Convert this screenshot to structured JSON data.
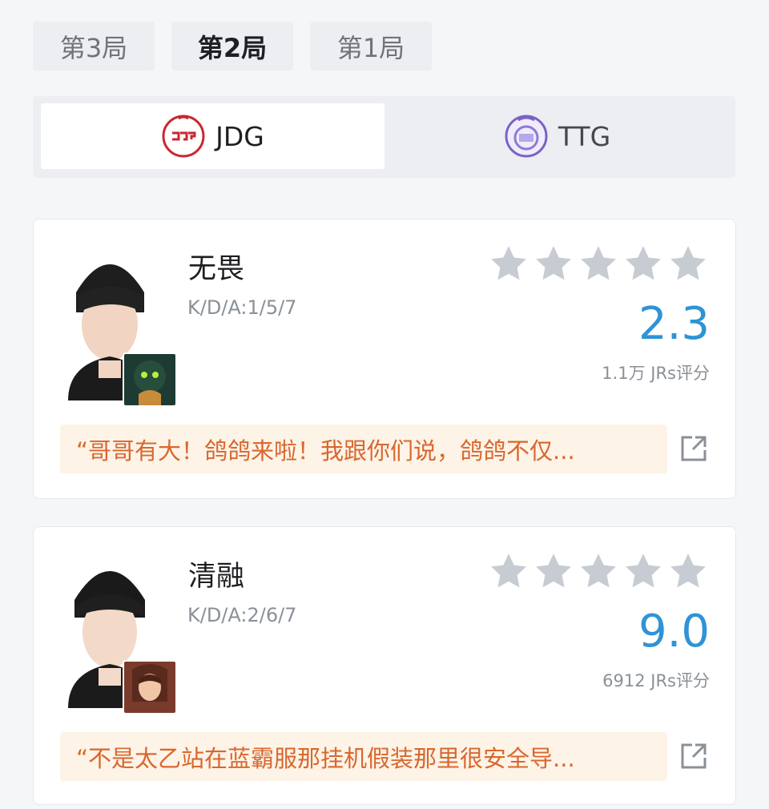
{
  "game_tabs": [
    {
      "label": "第3局",
      "active": false
    },
    {
      "label": "第2局",
      "active": true
    },
    {
      "label": "第1局",
      "active": false
    }
  ],
  "teams": [
    {
      "name": "JDG",
      "active": true,
      "logo_color": "#c8282f"
    },
    {
      "name": "TTG",
      "active": false,
      "logo_color": "#7a62c6"
    }
  ],
  "players": [
    {
      "name": "无畏",
      "kda": "K/D/A:1/5/7",
      "score": "2.3",
      "rating_count": "1.1万 JRs评分",
      "stars_filled": 0,
      "stars_total": 5,
      "comment": "“哥哥有大！鸽鸽来啦！我跟你们说，鸽鸽不仅...",
      "hero_icon": "hero-portrait-green"
    },
    {
      "name": "清融",
      "kda": "K/D/A:2/6/7",
      "score": "9.0",
      "rating_count": "6912 JRs评分",
      "stars_filled": 0,
      "stars_total": 5,
      "comment": "“不是太乙站在蓝霸服那挂机假装那里很安全导...",
      "hero_icon": "hero-portrait-red"
    }
  ],
  "colors": {
    "score": "#2f93d6",
    "comment_text": "#d9672f",
    "comment_bg": "#fdf3e6",
    "star": "#c7ccd3"
  }
}
